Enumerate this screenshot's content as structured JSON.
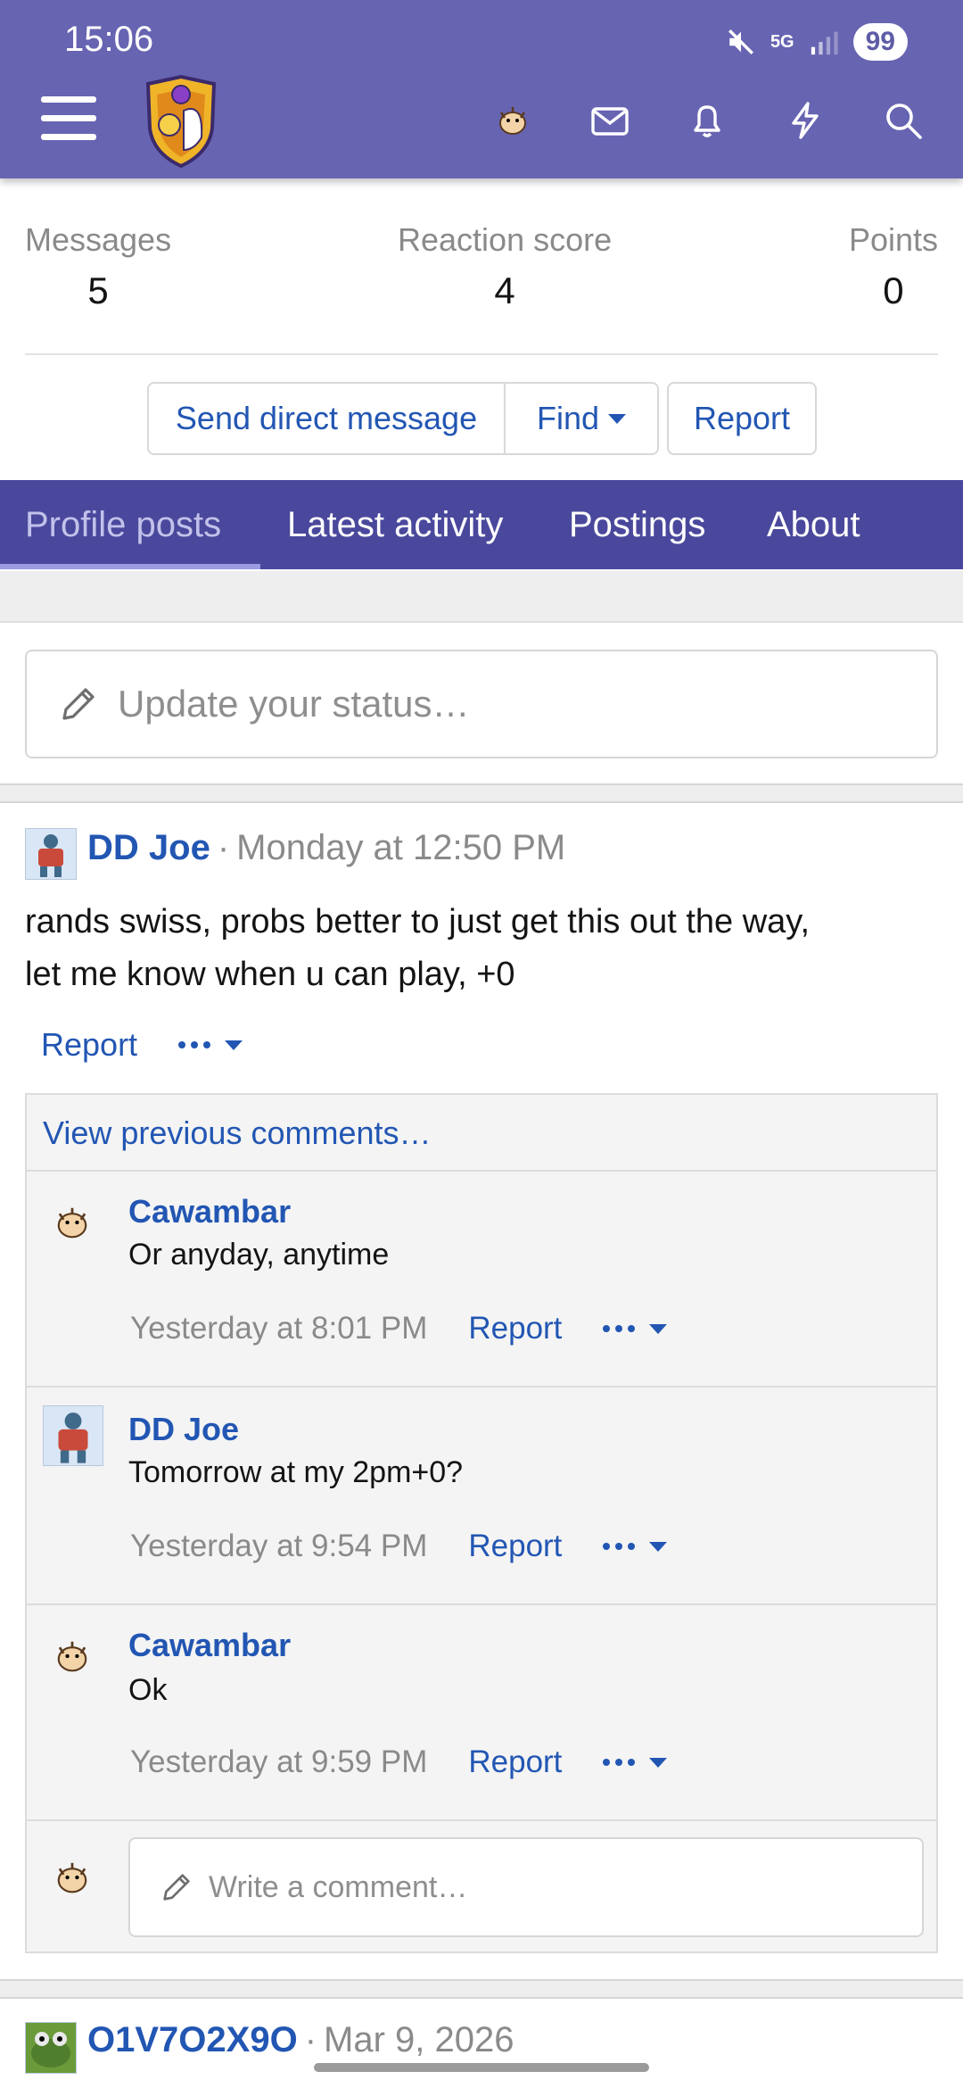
{
  "status_bar": {
    "time": "15:06",
    "network": "5G",
    "battery": "99"
  },
  "stats": [
    {
      "label": "Messages",
      "value": "5"
    },
    {
      "label": "Reaction score",
      "value": "4"
    },
    {
      "label": "Points",
      "value": "0"
    }
  ],
  "actions": {
    "send_dm": "Send direct message",
    "find": "Find",
    "report": "Report"
  },
  "tabs": [
    "Profile posts",
    "Latest activity",
    "Postings",
    "About"
  ],
  "status_input": {
    "placeholder": "Update your status…"
  },
  "post": {
    "author": "DD Joe",
    "time": "Monday at 12:50 PM",
    "body_line1": "rands swiss, probs better to just get this out the way,",
    "body_line2": "let me know when u can play, +0",
    "report": "Report"
  },
  "comments": {
    "view_previous": "View previous comments…",
    "items": [
      {
        "author": "Cawambar",
        "text": "Or anyday, anytime",
        "time": "Yesterday at 8:01 PM",
        "report": "Report"
      },
      {
        "author": "DD Joe",
        "text": "Tomorrow at my 2pm+0?",
        "time": "Yesterday at 9:54 PM",
        "report": "Report"
      },
      {
        "author": "Cawambar",
        "text": "Ok",
        "time": "Yesterday at 9:59 PM",
        "report": "Report"
      }
    ],
    "write_placeholder": "Write a comment…"
  },
  "next_post": {
    "author": "O1V7O2X9O",
    "time": "Mar 9, 2026"
  },
  "colors": {
    "header": "#6764b2",
    "tabs": "#4a489c",
    "link": "#2256b3"
  }
}
